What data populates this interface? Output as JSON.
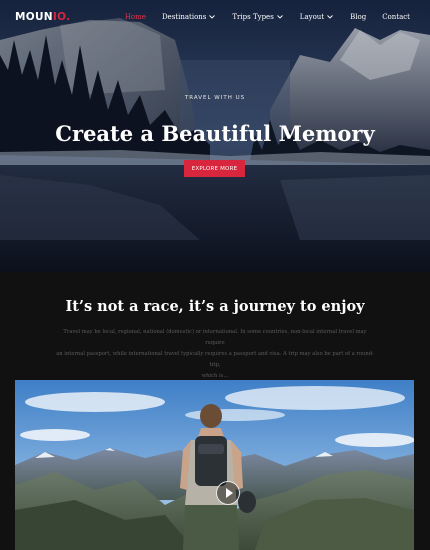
{
  "nav": {
    "logo_main": "MOUN",
    "logo_tail": "IO.",
    "items": [
      {
        "label": "Home",
        "active": true
      },
      {
        "label": "Destinations",
        "dropdown": true
      },
      {
        "label": "Trips Types",
        "dropdown": true
      },
      {
        "label": "Layout",
        "dropdown": true
      },
      {
        "label": "Blog"
      },
      {
        "label": "Contact"
      }
    ]
  },
  "hero": {
    "subtitle": "TRAVEL WITH US",
    "title": "Create a Beautiful Memory",
    "button_label": "EXPLORE MORE"
  },
  "intro": {
    "title": "It’s not a race, it’s a journey to enjoy",
    "line1": "Travel may be local, regional, national (domestic) or international. In some countries, non-local internal travel may require",
    "line2": "an internal passport, while international travel typically requires a passport and visa. A trip may also be part of a round-trip,",
    "line3": "which is..."
  },
  "video": {
    "icon": "play-icon"
  },
  "colors": {
    "accent": "#d7263d",
    "background": "#111111"
  }
}
